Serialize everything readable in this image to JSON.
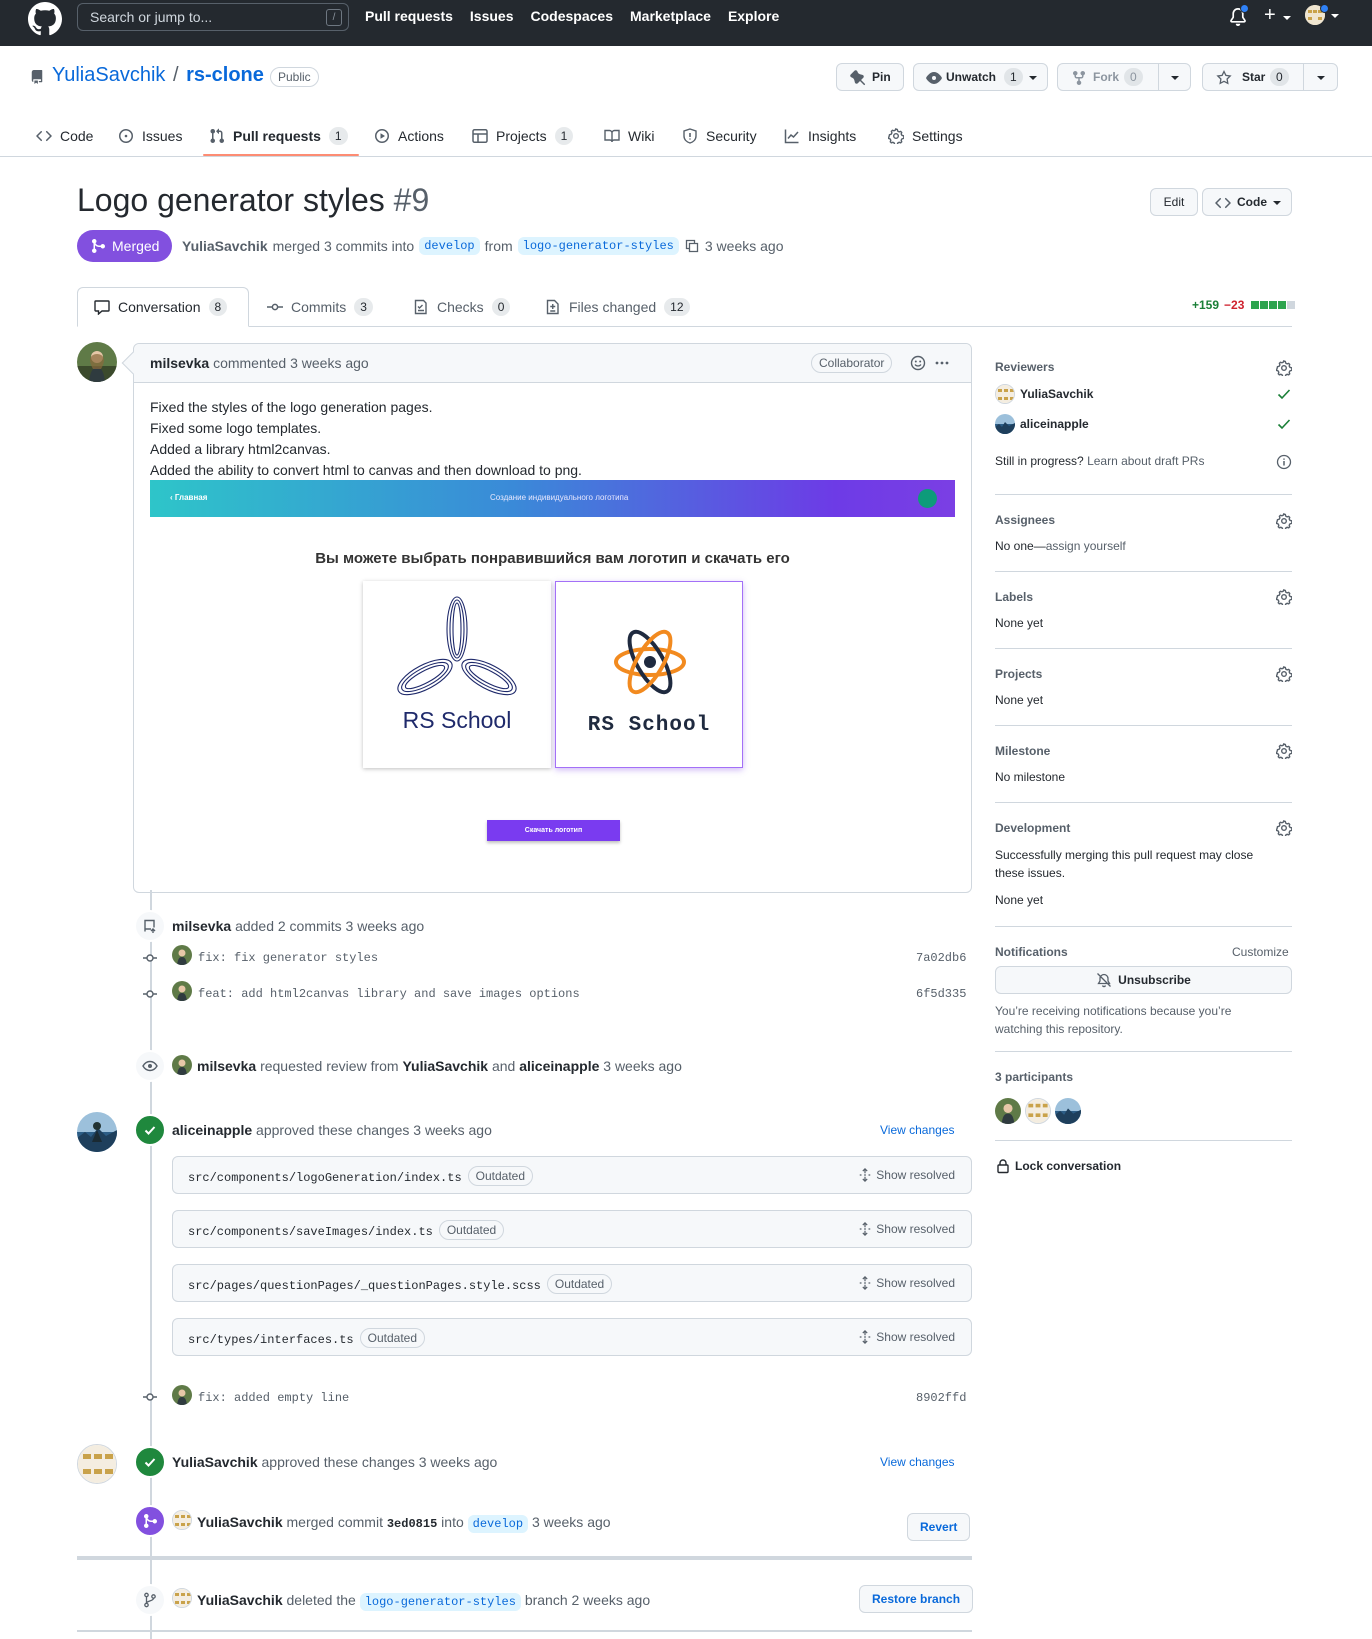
{
  "header": {
    "search_placeholder": "Search or jump to...",
    "search_shortcut": "/",
    "nav": [
      "Pull requests",
      "Issues",
      "Codespaces",
      "Marketplace",
      "Explore"
    ]
  },
  "repo": {
    "owner": "YuliaSavchik",
    "separator": "/",
    "name": "rs-clone",
    "visibility": "Public",
    "pin_label": "Pin",
    "unwatch_label": "Unwatch",
    "unwatch_count": "1",
    "fork_label": "Fork",
    "fork_count": "0",
    "star_label": "Star",
    "star_count": "0"
  },
  "repo_tabs": [
    {
      "label": "Code",
      "icon": "code-icon"
    },
    {
      "label": "Issues",
      "icon": "issue-icon"
    },
    {
      "label": "Pull requests",
      "icon": "pull-request-icon",
      "count": "1"
    },
    {
      "label": "Actions",
      "icon": "play-icon"
    },
    {
      "label": "Projects",
      "icon": "table-icon",
      "count": "1"
    },
    {
      "label": "Wiki",
      "icon": "book-icon"
    },
    {
      "label": "Security",
      "icon": "shield-icon"
    },
    {
      "label": "Insights",
      "icon": "graph-icon"
    },
    {
      "label": "Settings",
      "icon": "gear-icon"
    }
  ],
  "pr": {
    "title": "Logo generator styles",
    "number": "#9",
    "state": "Merged",
    "author": "YuliaSavchik",
    "merged_text": "merged 3 commits into",
    "base_branch": "develop",
    "from_text": "from",
    "head_branch": "logo-generator-styles",
    "time": "3 weeks ago",
    "edit_label": "Edit",
    "code_label": "Code"
  },
  "pr_tabs": [
    {
      "label": "Conversation",
      "count": "8"
    },
    {
      "label": "Commits",
      "count": "3"
    },
    {
      "label": "Checks",
      "count": "0"
    },
    {
      "label": "Files changed",
      "count": "12"
    }
  ],
  "diffstat": {
    "additions": "+159",
    "deletions": "−23"
  },
  "comment": {
    "author": "milsevka",
    "action": "commented 3 weeks ago",
    "role": "Collaborator",
    "lines": [
      "Fixed the styles of the logo generation pages.",
      "Fixed some logo templates.",
      "Added a library html2canvas.",
      "Added the ability to convert html to canvas and then download to png."
    ],
    "preview": {
      "nav_home": "‹ Главная",
      "nav_title": "Создание индивидуального логотипа",
      "heading": "Вы можете выбрать понравившийся вам логотип и скачать его",
      "logo1_text": "RS School",
      "logo2_text": "RS School",
      "download_button": "Скачать логотип"
    }
  },
  "timeline": {
    "commits_event": {
      "author": "milsevka",
      "text": "added 2 commits 3 weeks ago"
    },
    "commits": [
      {
        "message": "fix: fix generator styles",
        "sha": "7a02db6"
      },
      {
        "message": "feat: add html2canvas library and save images options",
        "sha": "6f5d335"
      }
    ],
    "review_request": {
      "author": "milsevka",
      "text1": "requested review from",
      "reviewer1": "YuliaSavchik",
      "text2": "and",
      "reviewer2": "aliceinapple",
      "time": "3 weeks ago"
    },
    "approval1": {
      "author": "aliceinapple",
      "text": "approved these changes 3 weeks ago",
      "link": "View changes"
    },
    "files": [
      {
        "path": "src/components/logoGeneration/index.ts",
        "badge": "Outdated",
        "action": "Show resolved"
      },
      {
        "path": "src/components/saveImages/index.ts",
        "badge": "Outdated",
        "action": "Show resolved"
      },
      {
        "path": "src/pages/questionPages/_questionPages.style.scss",
        "badge": "Outdated",
        "action": "Show resolved"
      },
      {
        "path": "src/types/interfaces.ts",
        "badge": "Outdated",
        "action": "Show resolved"
      }
    ],
    "commit3": {
      "message": "fix: added empty line",
      "sha": "8902ffd"
    },
    "approval2": {
      "author": "YuliaSavchik",
      "text": "approved these changes 3 weeks ago",
      "link": "View changes"
    },
    "merge": {
      "author": "YuliaSavchik",
      "text1": "merged commit",
      "sha": "3ed0815",
      "text2": "into",
      "branch": "develop",
      "time": "3 weeks ago",
      "button": "Revert"
    },
    "delete": {
      "author": "YuliaSavchik",
      "text1": "deleted the",
      "branch": "logo-generator-styles",
      "text2": "branch 2 weeks ago",
      "button": "Restore branch"
    }
  },
  "sidebar": {
    "reviewers_title": "Reviewers",
    "reviewers": [
      "YuliaSavchik",
      "aliceinapple"
    ],
    "draft_text": "Still in progress?",
    "draft_link": "Learn about draft PRs",
    "assignees_title": "Assignees",
    "assignees_value": "No one—",
    "assignees_link": "assign yourself",
    "labels_title": "Labels",
    "labels_value": "None yet",
    "projects_title": "Projects",
    "projects_value": "None yet",
    "milestone_title": "Milestone",
    "milestone_value": "No milestone",
    "development_title": "Development",
    "development_text": "Successfully merging this pull request may close these issues.",
    "development_value": "None yet",
    "notifications_title": "Notifications",
    "customize": "Customize",
    "unsubscribe": "Unsubscribe",
    "notif_reason": "You’re receiving notifications because you’re watching this repository.",
    "participants_title": "3 participants",
    "lock": "Lock conversation"
  }
}
